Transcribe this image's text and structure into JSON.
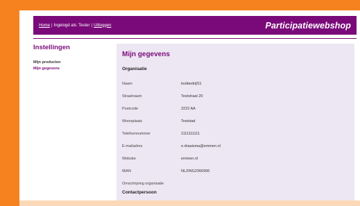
{
  "header": {
    "nav": {
      "home": "Home",
      "separator1": "|",
      "logged_in": "Ingelogd als: Tester",
      "separator2": "|",
      "logout": "Uitloggen"
    },
    "brand": "Participatiewebshop"
  },
  "sidebar": {
    "title": "Instellingen",
    "items": [
      {
        "label": "Mijn producten"
      },
      {
        "label": "Mijn gegevens"
      }
    ]
  },
  "main": {
    "title": "Mijn gegevens",
    "section_org": "Organisatie",
    "fields": [
      {
        "label": "Naam",
        "value": "testbedrijf11"
      },
      {
        "label": "Straatnaam",
        "value": "Teststraat 20"
      },
      {
        "label": "Postcode",
        "value": "2222 AA"
      },
      {
        "label": "Woonplaats",
        "value": "Teststad"
      },
      {
        "label": "Telefoonnummer",
        "value": "1111111111"
      },
      {
        "label": "E-mailadres",
        "value": "e.draaisma@emmen.nl"
      },
      {
        "label": "Website",
        "value": "emmen.nl"
      },
      {
        "label": "IBAN",
        "value": "NL2ING2366996"
      },
      {
        "label": "Omschrijving organisatie",
        "value": ""
      }
    ],
    "section_contact": "Contactpersoon"
  },
  "colors": {
    "accent": "#7a0a7a",
    "background": "#f5821f",
    "panel": "#ede6f3"
  }
}
